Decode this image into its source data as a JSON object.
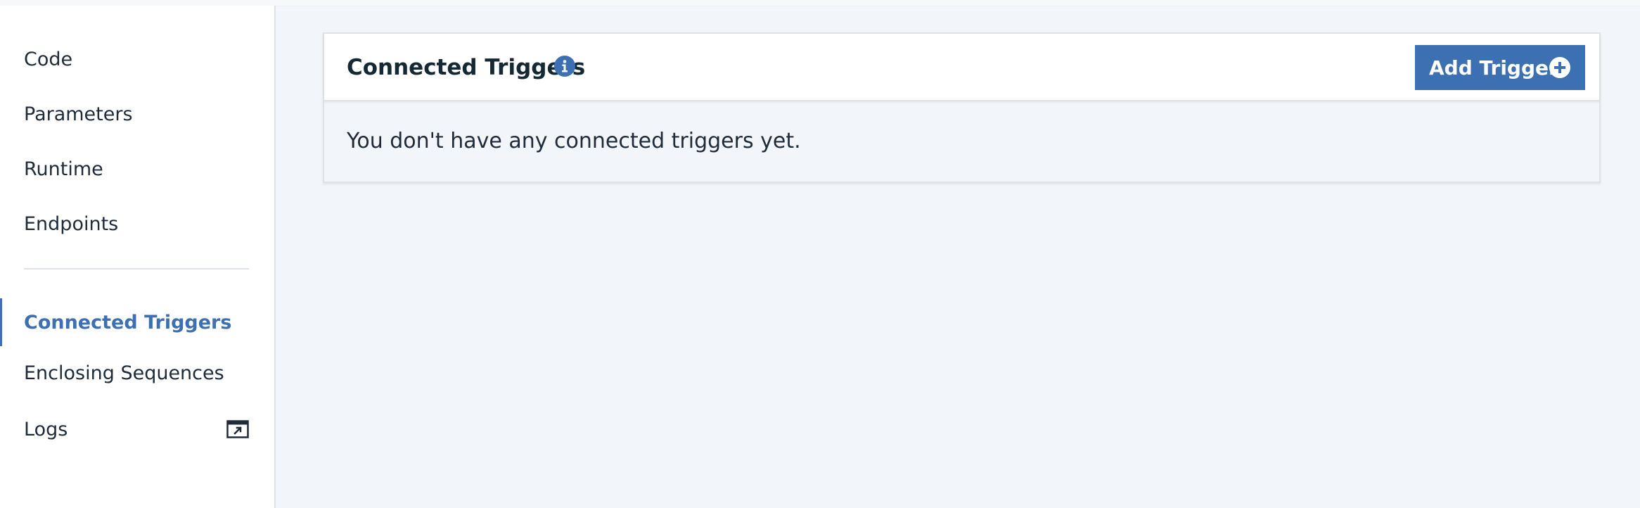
{
  "sidebar": {
    "items": [
      {
        "label": "Code"
      },
      {
        "label": "Parameters"
      },
      {
        "label": "Runtime"
      },
      {
        "label": "Endpoints"
      },
      {
        "label": "Connected Triggers",
        "active": true
      },
      {
        "label": "Enclosing Sequences"
      },
      {
        "label": "Logs",
        "icon": "external-link-icon"
      }
    ]
  },
  "panel": {
    "title": "Connected Triggers",
    "info_icon": "info-icon",
    "add_button_label": "Add Trigger",
    "add_button_icon": "plus-circle-icon",
    "empty_message": "You don't have any connected triggers yet."
  },
  "colors": {
    "accent": "#3d70b2",
    "background": "#f2f5f9",
    "text": "#1f2b38",
    "border": "#dfe3e8"
  }
}
